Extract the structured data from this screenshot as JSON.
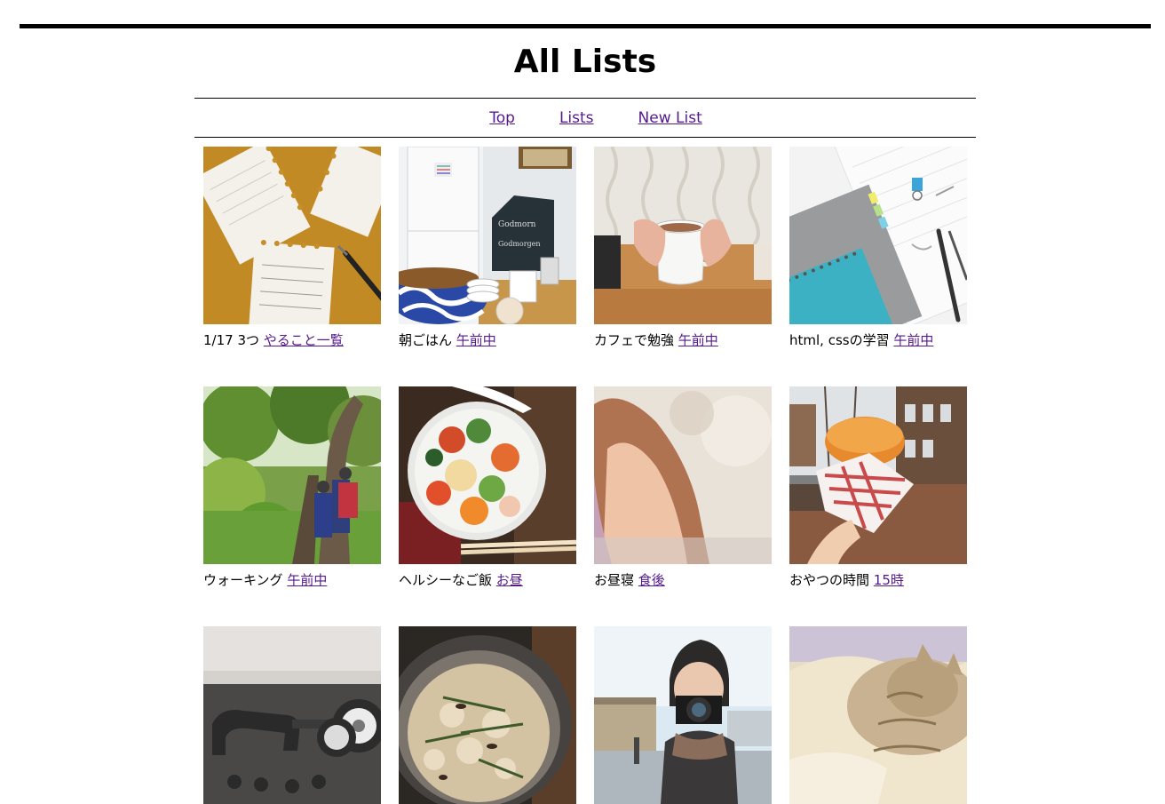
{
  "page": {
    "title": "All Lists"
  },
  "nav": {
    "items": [
      {
        "label": "Top"
      },
      {
        "label": "Lists"
      },
      {
        "label": "New List"
      }
    ]
  },
  "lists": [
    {
      "name": "1/17 3つ",
      "tag": "やること一覧",
      "image": "notepad-sheets-photo"
    },
    {
      "name": "朝ごはん",
      "tag": "午前中",
      "image": "kitchen-breakfast-photo"
    },
    {
      "name": "カフェで勉強",
      "tag": "午前中",
      "image": "coffee-mug-photo"
    },
    {
      "name": "html, cssの学習",
      "tag": "午前中",
      "image": "notebooks-pens-photo"
    },
    {
      "name": "ウォーキング",
      "tag": "午前中",
      "image": "forest-hikers-photo"
    },
    {
      "name": "ヘルシーなご飯",
      "tag": "お昼",
      "image": "salad-bowl-photo"
    },
    {
      "name": "お昼寝",
      "tag": "食後",
      "image": "sleeping-child-photo"
    },
    {
      "name": "おやつの時間",
      "tag": "15時",
      "image": "stroopwafel-street-photo"
    },
    {
      "name": "",
      "tag": "",
      "image": "ab-roller-photo"
    },
    {
      "name": "",
      "tag": "",
      "image": "rice-pot-photo"
    },
    {
      "name": "",
      "tag": "",
      "image": "photographer-camera-photo"
    },
    {
      "name": "",
      "tag": "",
      "image": "sleeping-cat-photo"
    }
  ]
}
